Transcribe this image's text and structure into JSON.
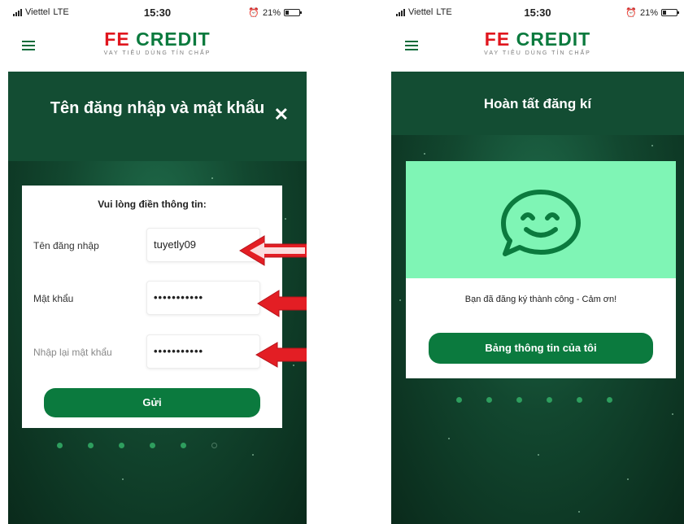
{
  "left_screen": {
    "status": {
      "carrier": "Viettel",
      "network": "LTE",
      "time": "15:30",
      "battery": "21%"
    },
    "brand": {
      "fe": "FE",
      "credit": "CREDIT",
      "tagline": "VAY TIÊU DÙNG TÍN CHẤP"
    },
    "title": "Tên đăng nhập và mật khẩu",
    "close_label": "✕",
    "form": {
      "prompt": "Vui lòng điền thông tin:",
      "username_label": "Tên đăng nhập",
      "username_value": "tuyetly09",
      "password_label": "Mật khẩu",
      "password_value": "•••••••••••",
      "confirm_label": "Nhập lại mật khẩu",
      "confirm_value": "•••••••••••",
      "submit_label": "Gửi"
    },
    "progress": {
      "total_steps": 6,
      "current_step": 5
    }
  },
  "right_screen": {
    "status": {
      "carrier": "Viettel",
      "network": "LTE",
      "time": "15:30",
      "battery": "21%"
    },
    "brand": {
      "fe": "FE",
      "credit": "CREDIT",
      "tagline": "VAY TIÊU DÙNG TÍN CHẤP"
    },
    "title": "Hoàn tất đăng kí",
    "success_message": "Bạn đã đăng ký thành công - Cảm ơn!",
    "dashboard_button": "Bảng thông tin của tôi",
    "progress": {
      "total_steps": 6,
      "current_step": 6
    }
  },
  "colors": {
    "brand_green": "#0b7a3e",
    "brand_red": "#e0161e",
    "header_dark_green": "#134d33",
    "mint": "#7ff5b5",
    "arrow_red": "#e31e24"
  },
  "icons": [
    "menu-icon",
    "close-icon",
    "smile-chat-icon",
    "arrow-left-icon"
  ]
}
